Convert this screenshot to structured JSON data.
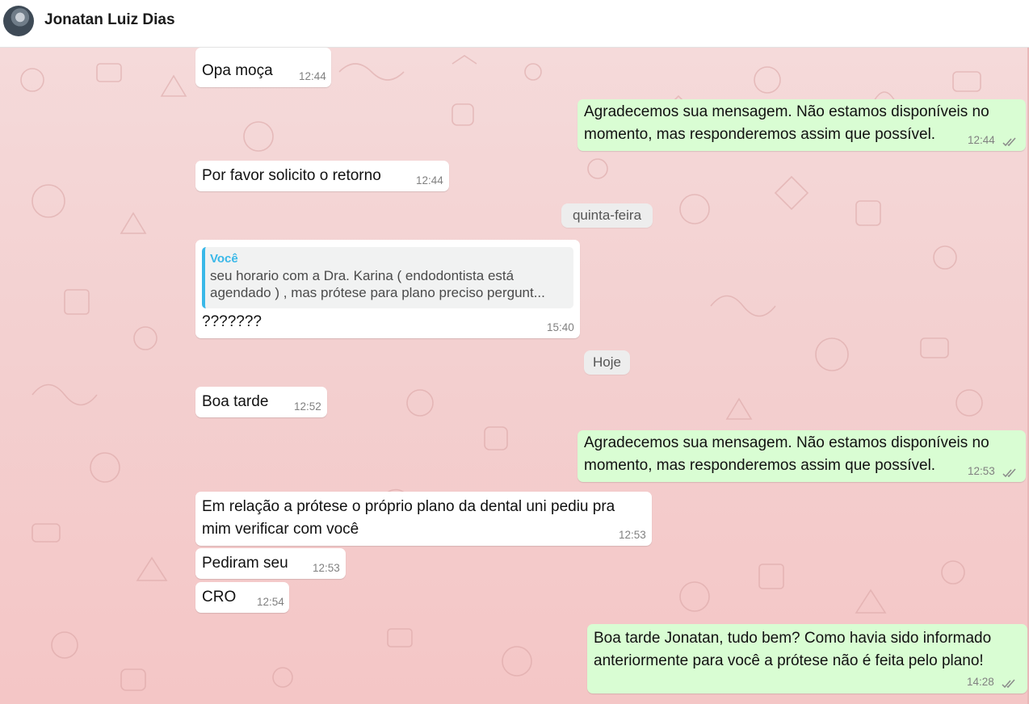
{
  "contact": {
    "name": "Jonatan Luiz Dias"
  },
  "day_chips": {
    "thursday": "quinta-feira",
    "today": "Hoje"
  },
  "messages": {
    "m1": {
      "text": "Opa moça",
      "time": "12:44"
    },
    "m2": {
      "line1": "Agradecemos sua mensagem. Não estamos disponíveis no",
      "line2": "momento, mas responderemos assim que possível.",
      "time": "12:44"
    },
    "m3": {
      "text": "Por favor solicito o retorno",
      "time": "12:44"
    },
    "m4": {
      "quote_author": "Você",
      "quote_line1": "seu horario com a Dra. Karina ( endodontista está",
      "quote_line2": "agendado ) , mas prótese para plano preciso pergunt...",
      "text": "???????",
      "time": "15:40"
    },
    "m5": {
      "text": "Boa tarde",
      "time": "12:52"
    },
    "m6": {
      "line1": "Agradecemos sua mensagem. Não estamos disponíveis no",
      "line2": "momento, mas responderemos assim que possível.",
      "time": "12:53"
    },
    "m7": {
      "line1": "Em relação a prótese o próprio plano da dental uni pediu pra",
      "line2": "mim verificar com você",
      "time": "12:53"
    },
    "m8": {
      "text": "Pediram seu",
      "time": "12:53"
    },
    "m9": {
      "text": "CRO",
      "time": "12:54"
    },
    "m10": {
      "line1": "Boa tarde Jonatan, tudo bem? Como havia sido informado",
      "line2": "anteriormente para você a prótese não é feita pelo plano!",
      "time": "14:28"
    }
  },
  "colors": {
    "incoming_bubble": "#ffffff",
    "outgoing_bubble": "#d9fdd3",
    "chat_background": "#f4cfcf",
    "quote_accent": "#3ab8e8"
  }
}
